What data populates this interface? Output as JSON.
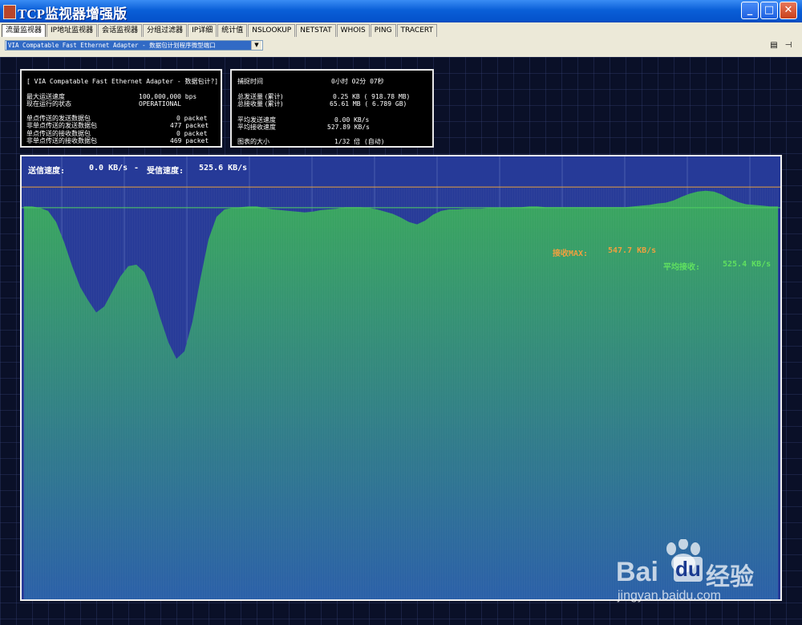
{
  "window": {
    "title": "TCP监视器增强版",
    "buttons": {
      "minimize": "_",
      "maximize": "□",
      "close": "✕"
    }
  },
  "tabs": [
    {
      "label": "流量监视器",
      "active": true
    },
    {
      "label": "IP地址监视器"
    },
    {
      "label": "会话监视器"
    },
    {
      "label": "分组过滤器"
    },
    {
      "label": "IP详细"
    },
    {
      "label": "统计值"
    },
    {
      "label": "NSLOOKUP"
    },
    {
      "label": "NETSTAT"
    },
    {
      "label": "WHOIS"
    },
    {
      "label": "PING"
    },
    {
      "label": "TRACERT"
    }
  ],
  "adapter_select": {
    "value": "VIA Compatable Fast Ethernet Adapter - 数据包计划程序微型端口"
  },
  "adapter_info": {
    "header": "[ VIA Compatable Fast Ethernet Adapter - 数据包计?]",
    "rows": [
      {
        "label": "最大运送速度",
        "value": "100,000,000 bps"
      },
      {
        "label": "现在运行的状态",
        "value": "OPERATIONAL"
      }
    ],
    "packets": [
      {
        "label": "单点传送的发送数据包",
        "value": "0 packet"
      },
      {
        "label": "非单点传送的发送数据包",
        "value": "477 packet"
      },
      {
        "label": "单点传送的接收数据包",
        "value": "0 packet"
      },
      {
        "label": "非单点传送的接收数据包",
        "value": "469 packet"
      }
    ]
  },
  "capture_info": {
    "capture_time_label": "捕捉时间",
    "capture_time_value": "0小时 02分 07秒",
    "total_sent_label": "总发送量 (累计)",
    "total_sent_value": "0.25 KB (  918.78 MB)",
    "total_recv_label": "总接收量 (累计)",
    "total_recv_value": "65.61 MB (  6.789 GB)",
    "avg_send_label": "平均发送速度",
    "avg_send_value": "0.00 KB/s",
    "avg_recv_label": "平均接收速度",
    "avg_recv_value": "527.89 KB/s",
    "graph_scale_label": "图表的大小",
    "graph_scale_value": "1/32 倍  (自动)"
  },
  "graph": {
    "send_label": "送信速度:",
    "send_value": "0.0 KB/s",
    "separator": "-",
    "recv_label": "受信速度:",
    "recv_value": "525.6 KB/s",
    "max_label": "接收MAX:",
    "max_value": "547.7 KB/s",
    "avg_label": "平均接收:",
    "avg_value": "525.4 KB/s",
    "colors": {
      "fill_top": "#39a85c",
      "fill_bottom": "#2a5fa8",
      "bg": "#263a98",
      "max_line": "#e8a040",
      "avg_line": "#50d060"
    }
  },
  "chart_data": {
    "type": "area",
    "series": [
      {
        "name": "受信速度",
        "values": [
          526,
          526,
          524,
          520,
          505,
          478,
          446,
          418,
          400,
          384,
          392,
          412,
          432,
          446,
          448,
          438,
          412,
          376,
          344,
          322,
          332,
          372,
          430,
          482,
          512,
          522,
          524,
          525,
          526,
          526,
          524,
          522,
          521,
          520,
          519,
          518,
          519,
          521,
          522,
          523,
          525,
          525,
          525,
          524,
          522,
          519,
          516,
          511,
          505,
          502,
          507,
          515,
          520,
          522,
          522,
          523,
          523,
          523,
          524,
          524,
          524,
          525,
          525,
          526,
          526,
          525,
          525,
          525,
          525,
          525,
          525,
          525,
          525,
          525,
          525,
          525,
          526,
          527,
          528,
          530,
          531,
          534,
          539,
          543,
          546,
          547,
          546,
          542,
          536,
          532,
          529,
          528,
          527,
          526,
          526
        ]
      }
    ],
    "ylim": [
      0,
      580
    ],
    "max_line": 547.7,
    "avg_line": 525.4
  },
  "watermark": {
    "brand": "Bai",
    "brand2": "du",
    "brand3": "经验",
    "url": "jingyan.baidu.com"
  }
}
